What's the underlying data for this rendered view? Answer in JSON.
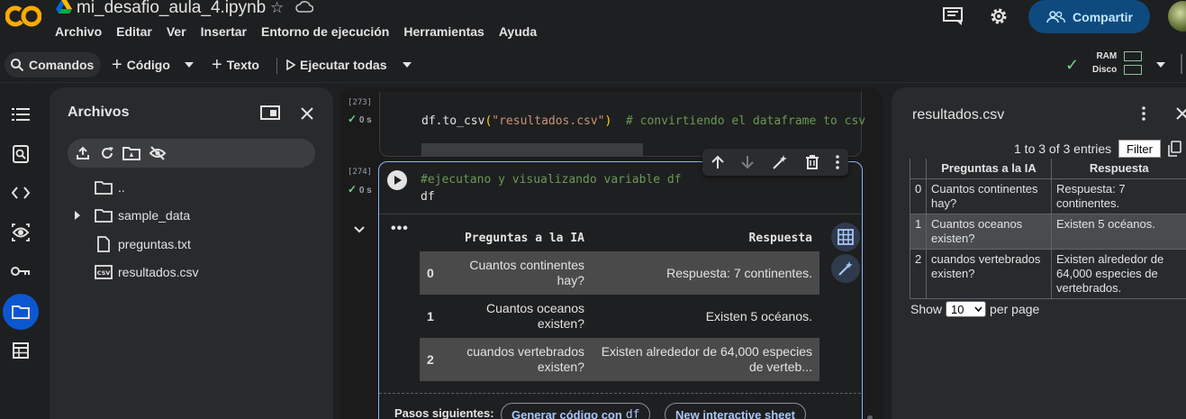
{
  "app": {
    "notebook_title": "mi_desafio_aula_4.ipynb",
    "menu": [
      "Archivo",
      "Editar",
      "Ver",
      "Insertar",
      "Entorno de ejecución",
      "Herramientas",
      "Ayuda"
    ],
    "share_label": "Compartir"
  },
  "toolbar": {
    "commands_label": "Comandos",
    "code_label": "Código",
    "text_label": "Texto",
    "run_all_label": "Ejecutar todas",
    "ram_label": "RAM",
    "disk_label": "Disco"
  },
  "files": {
    "title": "Archivos",
    "items": [
      {
        "name": "..",
        "icon": "folder-icon"
      },
      {
        "name": "sample_data",
        "icon": "folder-icon"
      },
      {
        "name": "preguntas.txt",
        "icon": "file-icon"
      },
      {
        "name": "resultados.csv",
        "icon": "csv-icon"
      }
    ]
  },
  "cells": [
    {
      "exec_count": "[273]",
      "exec_time": "0 s",
      "code_parts": [
        "df.to_csv",
        "(",
        "\"resultados.csv\"",
        ")",
        "  # convirtiendo el dataframe to csv"
      ]
    },
    {
      "exec_count": "[274]",
      "exec_time": "0 s",
      "code_comment": "#ejecutano y visualizando variable df",
      "code_line2": "df"
    }
  ],
  "output_table": {
    "headers": [
      "Preguntas a la IA",
      "Respuesta"
    ],
    "rows": [
      {
        "idx": "0",
        "q": "Cuantos continentes hay?",
        "a": "Respuesta: 7 continentes."
      },
      {
        "idx": "1",
        "q": "Cuantos oceanos existen?",
        "a": "Existen 5 océanos."
      },
      {
        "idx": "2",
        "q": "cuandos vertebrados existen?",
        "a": "Existen alrededor de 64,000 especies de verteb..."
      }
    ]
  },
  "next_steps": {
    "label": "Pasos siguientes:",
    "btn_generate": "Generar código con",
    "btn_generate_code": "df",
    "btn_sheet": "New interactive sheet"
  },
  "csv_viewer": {
    "title": "resultados.csv",
    "entries_text": "1 to 3 of 3 entries",
    "filter_label": "Filter",
    "headers": [
      "Preguntas a la IA",
      "Respuesta"
    ],
    "rows": [
      {
        "idx": "0",
        "q": "Cuantos continentes hay?",
        "a": "Respuesta: 7 continentes."
      },
      {
        "idx": "1",
        "q": "Cuantos oceanos existen?",
        "a": "Existen 5 océanos."
      },
      {
        "idx": "2",
        "q": "cuandos vertebrados existen?",
        "a": "Existen alrededor de 64,000 especies de vertebrados."
      }
    ],
    "show_label": "Show",
    "per_page_value": "10",
    "per_page_label": "per page"
  },
  "colors": {
    "accent": "#0b57d0",
    "share_bg": "#0f4a7e",
    "cell_focus": "#8ab4f8",
    "ok_green": "#6dd58c",
    "colab_orange": "#f9ab00"
  }
}
